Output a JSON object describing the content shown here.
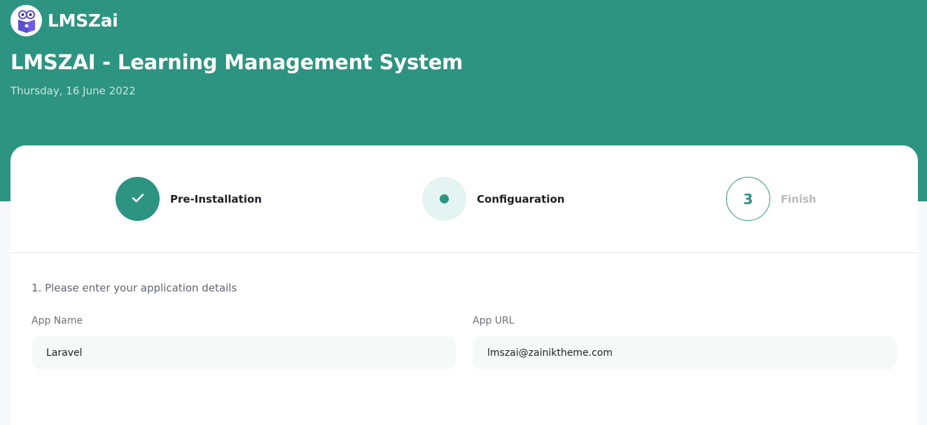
{
  "brand": {
    "name": "LMSZai",
    "logo_icon": "book-mascot-icon",
    "colors": {
      "primary": "#2d9481",
      "active_step_bg": "#e4f4f1"
    }
  },
  "header": {
    "title": "LMSZAI - Learning Management System",
    "date": "Thursday, 16 June 2022"
  },
  "steps": [
    {
      "status": "completed",
      "icon": "check-icon",
      "label": "Pre-Installation"
    },
    {
      "status": "active",
      "icon": "dot-icon",
      "label": "Configuaration"
    },
    {
      "status": "pending",
      "number": "3",
      "label": "Finish"
    }
  ],
  "form": {
    "section_title": "1. Please enter your application details",
    "app_name": {
      "label": "App Name",
      "value": "Laravel"
    },
    "app_url": {
      "label": "App URL",
      "value": "lmszai@zainiktheme.com"
    }
  }
}
